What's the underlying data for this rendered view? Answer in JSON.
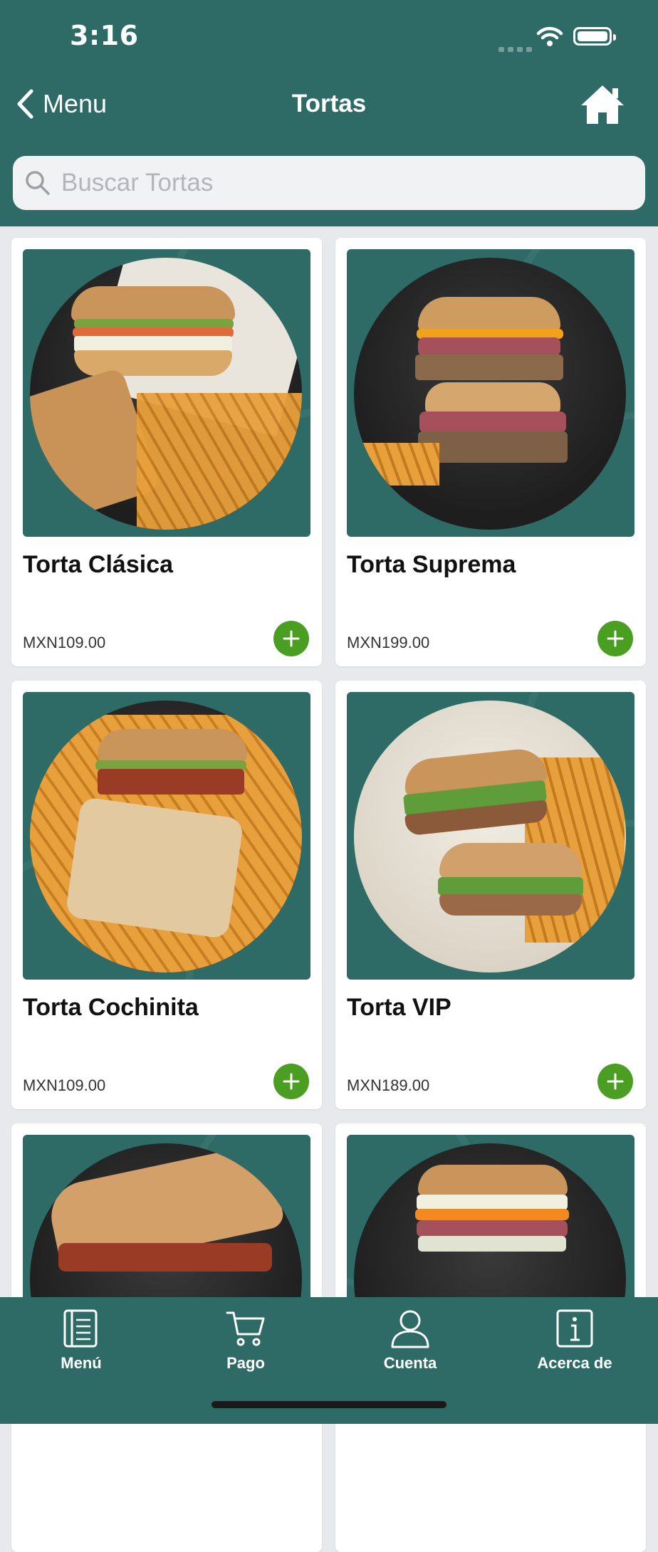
{
  "status_bar": {
    "time": "3:16"
  },
  "nav": {
    "back_label": "Menu",
    "title": "Tortas"
  },
  "search": {
    "placeholder": "Buscar Tortas"
  },
  "products": [
    {
      "name": "Torta Clásica",
      "price": "MXN109.00"
    },
    {
      "name": "Torta Suprema",
      "price": "MXN199.00"
    },
    {
      "name": "Torta Cochinita",
      "price": "MXN109.00"
    },
    {
      "name": "Torta VIP",
      "price": "MXN189.00"
    },
    {
      "name": "",
      "price": ""
    },
    {
      "name": "",
      "price": ""
    }
  ],
  "tabs": [
    {
      "label": "Menú",
      "icon": "menu-book-icon"
    },
    {
      "label": "Pago",
      "icon": "cart-icon"
    },
    {
      "label": "Cuenta",
      "icon": "user-icon"
    },
    {
      "label": "Acerca de",
      "icon": "info-icon"
    }
  ],
  "colors": {
    "header": "#2e6b66",
    "add_button": "#4a9e22",
    "background": "#e8e9ec"
  }
}
